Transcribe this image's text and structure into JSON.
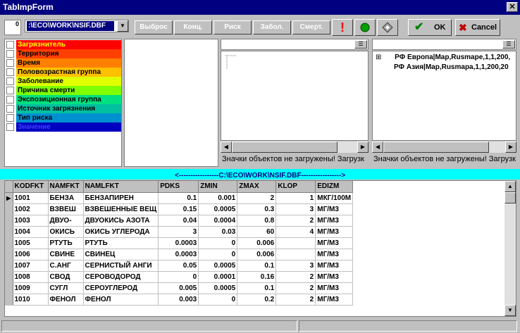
{
  "window": {
    "title": "TabImpForm",
    "close_glyph": "✕"
  },
  "toolbar": {
    "counter_value": "",
    "counter_label": "0",
    "path_value": ":\\ECO\\WORK\\NSIF.DBF",
    "dropdown_glyph": "▼",
    "buttons": [
      {
        "label": "Выброс",
        "color": "#ff0000"
      },
      {
        "label": "Конц.",
        "color": "#800000"
      },
      {
        "label": "Риск",
        "color": "#808000"
      },
      {
        "label": "Забол.",
        "color": "#00a000"
      },
      {
        "label": "Смерт.",
        "color": "#008080"
      }
    ],
    "icons": [
      "exclamation-icon",
      "green-circle-icon",
      "diamond-icon"
    ],
    "exclamation_glyph": "!",
    "ok_label": "OK",
    "ok_glyph": "✔",
    "cancel_label": "Cancel",
    "cancel_glyph": "✖"
  },
  "categories": [
    {
      "label": "Загрязнитель",
      "color": "#ff0000"
    },
    {
      "label": "Территория",
      "color": "#ff4000"
    },
    {
      "label": "Время",
      "color": "#ff8000"
    },
    {
      "label": "Половозрастная группа",
      "color": "#ffc000"
    },
    {
      "label": "Заболевание",
      "color": "#e0ff00"
    },
    {
      "label": "Причина смерти",
      "color": "#80ff00"
    },
    {
      "label": "Экспозиционная группа",
      "color": "#00e080"
    },
    {
      "label": "Источник загрязнения",
      "color": "#00c0a0"
    },
    {
      "label": "Тип риска",
      "color": "#0090d0"
    },
    {
      "label": "Значение",
      "color": "#0000c0"
    }
  ],
  "tree_panels": {
    "left": {
      "status": "Значки объектов не загружены! Загрузк"
    },
    "right": {
      "status": "Значки объектов не загружены! Загрузк",
      "items": [
        {
          "expander": "⊞",
          "label": "РФ Европа|Map,Rusmape,1,1,200,"
        },
        {
          "expander": "",
          "label": "РФ Азия|Map,Rusmapa,1,1,200,20"
        }
      ]
    }
  },
  "table": {
    "caption": "<-----------------C:\\ECO\\WORK\\NSIF.DBF----------------->",
    "columns": [
      "KODFKT",
      "NAMFKT",
      "NAMLFKT",
      "PDKS",
      "ZMIN",
      "ZMAX",
      "KLOP",
      "EDIZM"
    ],
    "rows": [
      [
        "1001",
        "БЕНЗА",
        "БЕНЗАПИРЕН",
        "0.1",
        "0.001",
        "2",
        "1",
        "МКГ/100М"
      ],
      [
        "1002",
        "ВЗВЕШ",
        "ВЗВЕШЕННЫЕ ВЕЩ",
        "0.15",
        "0.0005",
        "0.3",
        "3",
        "МГ/М3"
      ],
      [
        "1003",
        "ДВУО-",
        "ДВУОКИСЬ АЗОТА",
        "0.04",
        "0.0004",
        "0.8",
        "2",
        "МГ/М3"
      ],
      [
        "1004",
        "ОКИСЬ",
        "ОКИСЬ УГЛЕРОДА",
        "3",
        "0.03",
        "60",
        "4",
        "МГ/М3"
      ],
      [
        "1005",
        "РТУТЬ",
        "РТУТЬ",
        "0.0003",
        "0",
        "0.006",
        "",
        "МГ/М3"
      ],
      [
        "1006",
        "СВИНЕ",
        "СВИНЕЦ",
        "0.0003",
        "0",
        "0.006",
        "",
        "МГ/М3"
      ],
      [
        "1007",
        "С.АНГ",
        "СЕРНИСТЫЙ АНГИ",
        "0.05",
        "0.0005",
        "0.1",
        "3",
        "МГ/М3"
      ],
      [
        "1008",
        "СВОД",
        "СЕРОВОДОРОД",
        "0",
        "0.0001",
        "0.16",
        "2",
        "МГ/М3"
      ],
      [
        "1009",
        "СУГЛ",
        "СЕРОУГЛЕРОД",
        "0.005",
        "0.0005",
        "0.1",
        "2",
        "МГ/М3"
      ],
      [
        "1010",
        "ФЕНОЛ",
        "ФЕНОЛ",
        "0.003",
        "0",
        "0.2",
        "2",
        "МГ/М3"
      ]
    ],
    "current_row_glyph": "▶"
  },
  "scroll": {
    "left": "◀",
    "right": "▶",
    "up": "▲",
    "down": "▼",
    "menu": "☰"
  }
}
